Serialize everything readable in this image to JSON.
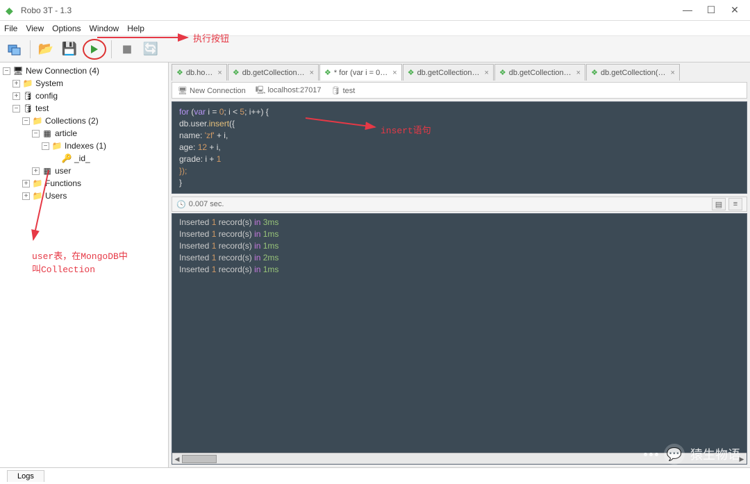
{
  "window": {
    "title": "Robo 3T - 1.3"
  },
  "menus": [
    "File",
    "View",
    "Options",
    "Window",
    "Help"
  ],
  "tree": {
    "root": "New Connection (4)",
    "items": [
      {
        "label": "System",
        "icon": "📁"
      },
      {
        "label": "config",
        "icon": "🛢"
      },
      {
        "label": "test",
        "icon": "🛢"
      }
    ],
    "collections_label": "Collections (2)",
    "article": {
      "label": "article",
      "indexes_label": "Indexes (1)",
      "id_label": "_id_"
    },
    "user_label": "user",
    "functions_label": "Functions",
    "users_label": "Users"
  },
  "tabs": [
    {
      "label": "db.ho…",
      "active": false
    },
    {
      "label": "db.getCollection…",
      "active": false
    },
    {
      "label": "* for (var i = 0…",
      "active": true
    },
    {
      "label": "db.getCollection…",
      "active": false
    },
    {
      "label": "db.getCollection…",
      "active": false
    },
    {
      "label": "db.getCollection(…",
      "active": false
    }
  ],
  "crumbs": {
    "conn": "New Connection",
    "host": "localhost:27017",
    "db": "test"
  },
  "code": {
    "l1a": "for",
    "l1b": " (",
    "l1c": "var",
    "l1d": " i = ",
    "l1e": "0",
    "l1f": "; i < ",
    "l1g": "5",
    "l1h": "; i++) {",
    "l2a": "    db.user.",
    "l2b": "insert",
    "l2c": "({",
    "l3a": "        name: ",
    "l3b": "'zf'",
    "l3c": " + i,",
    "l4a": "        age: ",
    "l4b": "12",
    "l4c": " + i,",
    "l5a": "        grade: i + ",
    "l5b": "1",
    "l6": "    });",
    "l7": "}"
  },
  "status": {
    "time": "0.007 sec."
  },
  "output_lines": [
    {
      "verb": "Inserted",
      "n": "1",
      "mid": " record(s) ",
      "in": "in",
      "t": " 3ms"
    },
    {
      "verb": "Inserted",
      "n": "1",
      "mid": " record(s) ",
      "in": "in",
      "t": " 1ms"
    },
    {
      "verb": "Inserted",
      "n": "1",
      "mid": " record(s) ",
      "in": "in",
      "t": " 1ms"
    },
    {
      "verb": "Inserted",
      "n": "1",
      "mid": " record(s) ",
      "in": "in",
      "t": " 2ms"
    },
    {
      "verb": "Inserted",
      "n": "1",
      "mid": " record(s) ",
      "in": "in",
      "t": " 1ms"
    }
  ],
  "annotations": {
    "run": "执行按钮",
    "insert": "insert语句",
    "user": "user表，在MongoDB中\n叫Collection"
  },
  "logs_label": "Logs",
  "watermark": "猿生物语"
}
